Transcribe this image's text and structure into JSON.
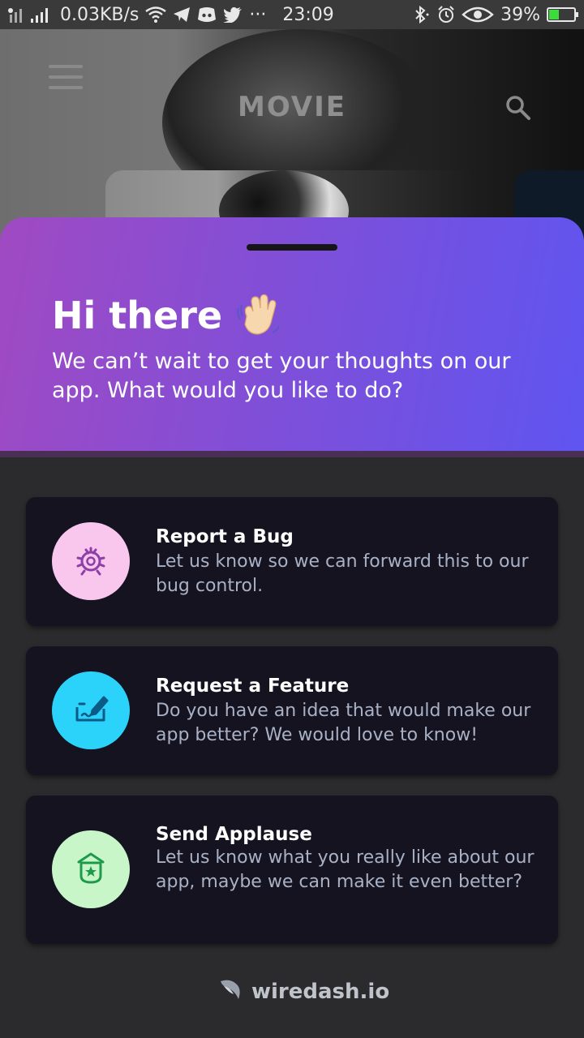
{
  "status_bar": {
    "network_speed": "0.03KB/s",
    "more_indicator": "···",
    "time": "23:09",
    "battery": "39%",
    "battery_level": 0.39,
    "icons": [
      "signal-icon",
      "wifi-icon",
      "telegram-icon",
      "discord-icon",
      "twitter-icon",
      "bluetooth-icon",
      "alarm-icon",
      "eye-icon",
      "battery-icon"
    ]
  },
  "app": {
    "title": "MOVIE",
    "icons": [
      "menu-icon",
      "search-icon"
    ]
  },
  "sheet": {
    "greeting": "Hi there",
    "greeting_emoji": "waving-hand-icon",
    "subtitle": "We can’t wait to get your thoughts on our app. What would you like to do?",
    "options": [
      {
        "title": "Report a Bug",
        "description": "Let us know so we can forward this to our bug control.",
        "icon": "bug-icon",
        "icon_bg": "#f9c6ee",
        "icon_color": "#8e3fa6"
      },
      {
        "title": "Request a Feature",
        "description": "Do you have an idea that would make our app better? We would love to know!",
        "icon": "feature-idea-icon",
        "icon_bg": "#2bd3fb",
        "icon_color": "#0c5a86"
      },
      {
        "title": "Send Applause",
        "description": "Let us know what you really like about our app, maybe we can make it even better?",
        "icon": "applause-badge-icon",
        "icon_bg": "#c9f6c9",
        "icon_color": "#1e9a4a"
      }
    ],
    "footer_brand": "wiredash.io"
  },
  "colors": {
    "header_gradient_start": "#a04ac2",
    "header_gradient_end": "#5f55f0",
    "card_bg": "#14131f",
    "sheet_bg": "#2b2b2d"
  }
}
